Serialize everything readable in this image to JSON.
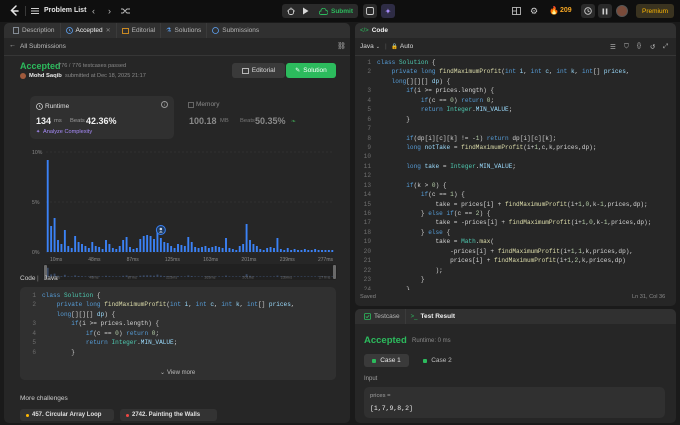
{
  "topbar": {
    "problem_list": "Problem List",
    "submit": "Submit",
    "streak": "209",
    "premium": "Premium"
  },
  "left_tabs": {
    "description": "Description",
    "accepted": "Accepted",
    "editorial": "Editorial",
    "solutions": "Solutions",
    "submissions": "Submissions"
  },
  "left": {
    "back": "All Submissions",
    "status": "Accepted",
    "testcases": "776 / 776 testcases passed",
    "user": "Mohd Saqib",
    "submitted": "submitted at Dec 18, 2025 21:17",
    "editorial_btn": "Editorial",
    "solution_btn": "Solution",
    "runtime": {
      "label": "Runtime",
      "value": "134",
      "unit": "ms",
      "beats_label": "Beats",
      "beats": "42.36%",
      "analyze": "Analyze Complexity"
    },
    "memory": {
      "label": "Memory",
      "value": "100.18",
      "unit": "MB",
      "beats_label": "Beats",
      "beats": "50.35%"
    },
    "code_header": "Code",
    "code_lang": "Java",
    "view_more": "View more",
    "more_challenges": "More challenges",
    "challenges": [
      "457. Circular Array Loop",
      "2742. Painting the Walls"
    ]
  },
  "chart_data": {
    "type": "bar",
    "y_ticks": [
      "10%",
      "5%",
      "0%"
    ],
    "ylim": [
      0,
      10
    ],
    "x_labels": [
      "10ms",
      "48ms",
      "87ms",
      "125ms",
      "163ms",
      "201ms",
      "239ms",
      "277ms"
    ],
    "mini_labels": [
      "10ms",
      "48ms",
      "87ms",
      "125ms",
      "163ms",
      "201ms",
      "239ms",
      "277ms"
    ],
    "values": [
      9.2,
      2.6,
      3.4,
      1.2,
      0.8,
      2.2,
      0.6,
      0.4,
      1.6,
      1.0,
      0.8,
      0.6,
      0.4,
      1.0,
      0.6,
      0.5,
      0.3,
      1.2,
      0.8,
      0.4,
      0.3,
      0.6,
      1.2,
      1.5,
      0.5,
      0.3,
      0.4,
      1.3,
      1.6,
      1.7,
      1.6,
      1.3,
      2.4,
      1.4,
      1.0,
      0.9,
      0.6,
      0.4,
      0.8,
      0.7,
      0.6,
      1.5,
      1.0,
      0.5,
      0.4,
      0.5,
      0.6,
      0.4,
      0.5,
      0.6,
      0.5,
      0.4,
      1.4,
      0.4,
      0.3,
      0.2,
      0.6,
      0.8,
      2.8,
      1.2,
      0.8,
      0.6,
      0.3,
      0.2,
      0.4,
      0.5,
      0.4,
      1.4,
      0.3,
      0.2,
      0.4,
      0.2,
      0.3,
      0.2,
      0.2,
      0.3,
      0.2,
      0.2,
      0.3,
      0.2,
      0.2,
      0.2,
      0.2,
      0.2
    ],
    "highlight_index": 33,
    "bar_color": "#3b82f6"
  },
  "code_panel": {
    "title": "Code",
    "lang": "Java",
    "auto": "Auto",
    "saved": "Saved",
    "position": "Ln 31, Col 36"
  },
  "code_lines": [
    [
      [
        "kw",
        "class "
      ],
      [
        "ty",
        "Solution"
      ],
      [
        "pl",
        " {"
      ]
    ],
    [
      [
        "pl",
        "    "
      ],
      [
        "kw",
        "private long "
      ],
      [
        "fn",
        "findMaximumProfit"
      ],
      [
        "pl",
        "("
      ],
      [
        "kw",
        "int "
      ],
      [
        "tx",
        "i"
      ],
      [
        "pl",
        ", "
      ],
      [
        "kw",
        "int "
      ],
      [
        "tx",
        "c"
      ],
      [
        "pl",
        ", "
      ],
      [
        "kw",
        "int "
      ],
      [
        "tx",
        "k"
      ],
      [
        "pl",
        ", "
      ],
      [
        "kw",
        "int"
      ],
      [
        "pl",
        "[] "
      ],
      [
        "tx",
        "prices"
      ],
      [
        "pl",
        ","
      ]
    ],
    [
      [
        "pl",
        "    "
      ],
      [
        "kw",
        "long"
      ],
      [
        "pl",
        "[][][] "
      ],
      [
        "tx",
        "dp"
      ],
      [
        "pl",
        ") {"
      ]
    ],
    [
      [
        "pl",
        "        "
      ],
      [
        "kw",
        "if"
      ],
      [
        "pl",
        "(i >= prices.length) {"
      ]
    ],
    [
      [
        "pl",
        "            "
      ],
      [
        "kw",
        "if"
      ],
      [
        "pl",
        "(c == "
      ],
      [
        "nu",
        "0"
      ],
      [
        "pl",
        ") "
      ],
      [
        "kw",
        "return "
      ],
      [
        "nu",
        "0"
      ],
      [
        "pl",
        ";"
      ]
    ],
    [
      [
        "pl",
        "            "
      ],
      [
        "kw",
        "return "
      ],
      [
        "ty",
        "Integer"
      ],
      [
        "pl",
        "."
      ],
      [
        "tx",
        "MIN_VALUE"
      ],
      [
        "pl",
        ";"
      ]
    ],
    [
      [
        "pl",
        "        }"
      ]
    ],
    [
      [
        "pl",
        ""
      ]
    ],
    [
      [
        "pl",
        "        "
      ],
      [
        "kw",
        "if"
      ],
      [
        "pl",
        "(dp[i][c][k] != -"
      ],
      [
        "nu",
        "1"
      ],
      [
        "pl",
        ") "
      ],
      [
        "kw",
        "return "
      ],
      [
        "pl",
        "dp[i][c][k];"
      ]
    ],
    [
      [
        "pl",
        "        "
      ],
      [
        "kw",
        "long "
      ],
      [
        "tx",
        "notTake"
      ],
      [
        "pl",
        " = "
      ],
      [
        "fn",
        "findMaximumProfit"
      ],
      [
        "pl",
        "(i+"
      ],
      [
        "nu",
        "1"
      ],
      [
        "pl",
        ",c,k,prices,dp);"
      ]
    ],
    [
      [
        "pl",
        ""
      ]
    ],
    [
      [
        "pl",
        "        "
      ],
      [
        "kw",
        "long "
      ],
      [
        "tx",
        "take"
      ],
      [
        "pl",
        " = "
      ],
      [
        "ty",
        "Integer"
      ],
      [
        "pl",
        "."
      ],
      [
        "tx",
        "MIN_VALUE"
      ],
      [
        "pl",
        ";"
      ]
    ],
    [
      [
        "pl",
        ""
      ]
    ],
    [
      [
        "pl",
        "        "
      ],
      [
        "kw",
        "if"
      ],
      [
        "pl",
        "(k > "
      ],
      [
        "nu",
        "0"
      ],
      [
        "pl",
        ") {"
      ]
    ],
    [
      [
        "pl",
        "            "
      ],
      [
        "kw",
        "if"
      ],
      [
        "pl",
        "(c == "
      ],
      [
        "nu",
        "1"
      ],
      [
        "pl",
        ") {"
      ]
    ],
    [
      [
        "pl",
        "                take = prices[i] + "
      ],
      [
        "fn",
        "findMaximumProfit"
      ],
      [
        "pl",
        "(i+"
      ],
      [
        "nu",
        "1"
      ],
      [
        "pl",
        ","
      ],
      [
        "nu",
        "0"
      ],
      [
        "pl",
        ",k-"
      ],
      [
        "nu",
        "1"
      ],
      [
        "pl",
        ",prices,dp);"
      ]
    ],
    [
      [
        "pl",
        "            } "
      ],
      [
        "kw",
        "else if"
      ],
      [
        "pl",
        "(c == "
      ],
      [
        "nu",
        "2"
      ],
      [
        "pl",
        ") {"
      ]
    ],
    [
      [
        "pl",
        "                take = -prices[i] + "
      ],
      [
        "fn",
        "findMaximumProfit"
      ],
      [
        "pl",
        "(i+"
      ],
      [
        "nu",
        "1"
      ],
      [
        "pl",
        ","
      ],
      [
        "nu",
        "0"
      ],
      [
        "pl",
        ",k-"
      ],
      [
        "nu",
        "1"
      ],
      [
        "pl",
        ",prices,dp);"
      ]
    ],
    [
      [
        "pl",
        "            } "
      ],
      [
        "kw",
        "else"
      ],
      [
        "pl",
        " {"
      ]
    ],
    [
      [
        "pl",
        "                take = "
      ],
      [
        "ty",
        "Math"
      ],
      [
        "pl",
        "."
      ],
      [
        "fn",
        "max"
      ],
      [
        "pl",
        "("
      ]
    ],
    [
      [
        "pl",
        "                    -prices[i] + "
      ],
      [
        "fn",
        "findMaximumProfit"
      ],
      [
        "pl",
        "(i+"
      ],
      [
        "nu",
        "1"
      ],
      [
        "pl",
        ","
      ],
      [
        "nu",
        "1"
      ],
      [
        "pl",
        ",k,prices,dp),"
      ]
    ],
    [
      [
        "pl",
        "                    prices[i] + "
      ],
      [
        "fn",
        "findMaximumProfit"
      ],
      [
        "pl",
        "(i+"
      ],
      [
        "nu",
        "1"
      ],
      [
        "pl",
        ","
      ],
      [
        "nu",
        "2"
      ],
      [
        "pl",
        ",k,prices,dp)"
      ]
    ],
    [
      [
        "pl",
        "                );"
      ]
    ],
    [
      [
        "pl",
        "            }"
      ]
    ],
    [
      [
        "pl",
        "        }"
      ]
    ]
  ],
  "code_line_numbers": [
    "1",
    "2",
    "",
    "3",
    "4",
    "5",
    "6",
    "7",
    "8",
    "9",
    "10",
    "11",
    "12",
    "13",
    "14",
    "15",
    "16",
    "17",
    "18",
    "19",
    "20",
    "21",
    "22",
    "23",
    "24"
  ],
  "snippet_lines": [
    [
      [
        "kw",
        "class "
      ],
      [
        "ty",
        "Solution"
      ],
      [
        "pl",
        " {"
      ]
    ],
    [
      [
        "pl",
        "    "
      ],
      [
        "kw",
        "private long "
      ],
      [
        "fn",
        "findMaximumProfit"
      ],
      [
        "pl",
        "("
      ],
      [
        "kw",
        "int "
      ],
      [
        "tx",
        "i"
      ],
      [
        "pl",
        ", "
      ],
      [
        "kw",
        "int "
      ],
      [
        "tx",
        "c"
      ],
      [
        "pl",
        ", "
      ],
      [
        "kw",
        "int "
      ],
      [
        "tx",
        "k"
      ],
      [
        "pl",
        ", "
      ],
      [
        "kw",
        "int"
      ],
      [
        "pl",
        "[] "
      ],
      [
        "tx",
        "prices"
      ],
      [
        "pl",
        ","
      ]
    ],
    [
      [
        "pl",
        "    "
      ],
      [
        "kw",
        "long"
      ],
      [
        "pl",
        "[][][] "
      ],
      [
        "tx",
        "dp"
      ],
      [
        "pl",
        ") {"
      ]
    ],
    [
      [
        "pl",
        "        "
      ],
      [
        "kw",
        "if"
      ],
      [
        "pl",
        "(i >= prices.length) {"
      ]
    ],
    [
      [
        "pl",
        "            "
      ],
      [
        "kw",
        "if"
      ],
      [
        "pl",
        "(c == "
      ],
      [
        "nu",
        "0"
      ],
      [
        "pl",
        ") "
      ],
      [
        "kw",
        "return "
      ],
      [
        "nu",
        "0"
      ],
      [
        "pl",
        ";"
      ]
    ],
    [
      [
        "pl",
        "            "
      ],
      [
        "kw",
        "return "
      ],
      [
        "ty",
        "Integer"
      ],
      [
        "pl",
        "."
      ],
      [
        "tx",
        "MIN_VALUE"
      ],
      [
        "pl",
        ";"
      ]
    ],
    [
      [
        "pl",
        "        }"
      ]
    ]
  ],
  "snippet_line_numbers": [
    "1",
    "2",
    "",
    "3",
    "4",
    "5",
    "6"
  ],
  "bottom": {
    "testcase_tab": "Testcase",
    "result_tab": "Test Result",
    "status": "Accepted",
    "runtime": "Runtime: 0 ms",
    "case1": "Case 1",
    "case2": "Case 2",
    "input_label": "Input",
    "var_name": "prices =",
    "var_value": "[1,7,9,8,2]"
  }
}
